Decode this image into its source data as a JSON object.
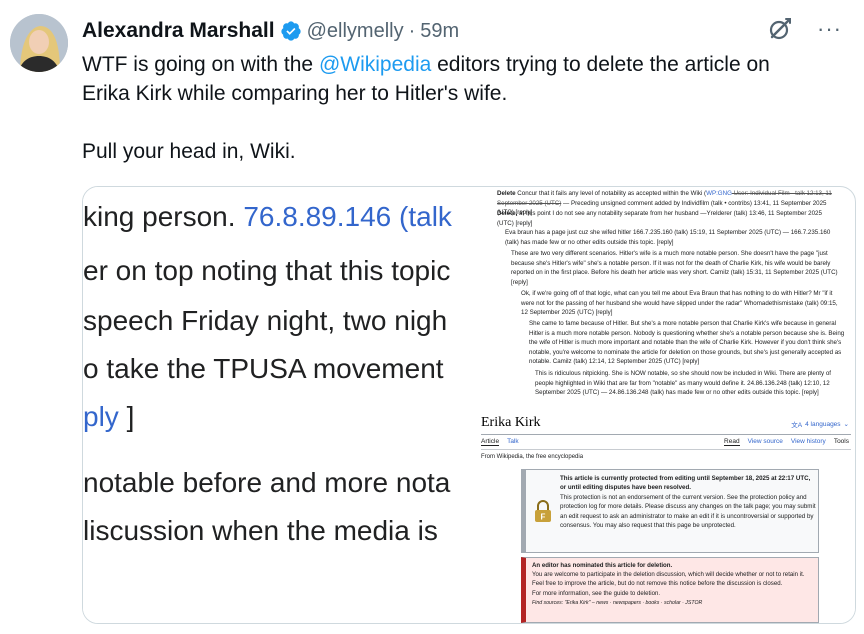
{
  "author": {
    "display_name": "Alexandra Marshall",
    "handle": "@ellymelly",
    "separator": "·",
    "time": "59m"
  },
  "icons": {
    "verified": "verified-badge-icon",
    "grok": "grok-icon",
    "more": "more-icon",
    "more_glyph": "···"
  },
  "colors": {
    "accent": "#1d9bf0",
    "wiki_link": "#3366cc",
    "afd_border": "#b32424"
  },
  "tweet": {
    "line1_pre": "WTF is going on with the ",
    "mention": "@Wikipedia",
    "line1_post": " editors trying to delete the article on",
    "line2": "Erika Kirk while comparing her to Hitler's wife.",
    "line3": "Pull your head in, Wiki."
  },
  "zoom": {
    "l1_text": "king person. ",
    "l1_ip": "76.8.89.146",
    "l1_paren": " (talk",
    "l2": "er on top noting that this topic",
    "l3": " speech Friday night, two nigh",
    "l4": "o take the TPUSA movement",
    "l5_link": "ply",
    "l5_bracket": " ]",
    "l6": "notable before and more nota",
    "l7": "liscussion when the media is"
  },
  "talk": {
    "p1_bold": "Delete",
    "p1_text": " Concur that it fails any level of notability as accepted within the Wiki (",
    "p1_link": "WP:GNG",
    "p1_strike": " User: Individual Film · talk 12:13, 11 September 2025 (UTC)",
    "p1_rest": " — Preceding unsigned comment added by Individfilm (talk • contribs) 13:41, 11 September 2025 (UTC) [reply]",
    "p2_bold": "Delete,",
    "p2_text": " at this point I do not see any notability separate from her husband —Yrelderer (talk) 13:46, 11 September 2025 (UTC) [reply]",
    "p3_text": "Eva braun has a page just cuz she wifed hitler 166.7.235.160 (talk) 15:19, 11 September 2025 (UTC) — 166.7.235.160 (talk) has made few or no other edits outside this topic.  [reply]",
    "p4_text": "These are two very different scenarios. Hitler's wife is a much more notable person. She doesn't have the page \"just because she's Hitler's wife\" she's a notable person. If it was not for the death of Charlie Kirk, his wife would be barely reported on in the first place. Before his death her article was very short. Camilz (talk) 15:31, 11 September 2025 (UTC) [reply]",
    "p5_text": "Ok, if we're going off of that logic, what can you tell me about Eva Braun that has nothing to do with Hitler? Mr \"if it were not for the passing of her husband she would have slipped under the radar\" Whomadethismistake (talk) 09:15, 12 September 2025 (UTC)  [reply]",
    "p6_text": "She came to fame because of Hitler. But she's a more notable person that Charlie Kirk's wife because in general Hitler is a much more notable person. Nobody is questioning whether she's a notable person because she is. Being the wife of Hitler is much more important and notable than the wife of Charlie Kirk. However if you don't think she's notable, you're welcome to nominate the article for deletion on those grounds, but she's just generally accepted as notable. Camilz (talk) 12:14, 12 September 2025 (UTC) [reply]",
    "p7_text": "This is ridiculous nitpicking. She is NOW notable, so she should now be included in Wiki. There are plenty of people highlighted in Wiki that are far from \"notable\" as many would define it. 24.86.136.248 (talk) 12:10, 12 September 2025 (UTC) — 24.86.136.248 (talk) has made few or no other edits outside this topic.  [reply]"
  },
  "wiki": {
    "title": "Erika Kirk",
    "languages": "4 languages",
    "tab_article": "Article",
    "tab_talk": "Talk",
    "tab_read": "Read",
    "tab_view_source": "View source",
    "tab_view_history": "View history",
    "tab_tools": "Tools",
    "from": "From Wikipedia, the free encyclopedia",
    "prot_line1": "This article is currently protected from editing until September 18, 2025 at 22:17 UTC, or until editing disputes have been resolved.",
    "prot_line2": "This protection is not an endorsement of the current version. See the protection policy and protection log for more details. Please discuss any changes on the talk page; you may submit an edit request to ask an administrator to make an edit if it is uncontroversial or supported by consensus. You may also request that this page be unprotected.",
    "afd_title": "An editor has nominated this article for deletion.",
    "afd_line1": "You are welcome to participate in the deletion discussion, which will decide whether or not to retain it.",
    "afd_line2": "Feel free to improve the article, but do not remove this notice before the discussion is closed.",
    "afd_line3": "For more information, see the guide to deletion.",
    "afd_sources": "Find sources: \"Erika Kirk\" – news · newspapers · books · scholar · JSTOR"
  }
}
